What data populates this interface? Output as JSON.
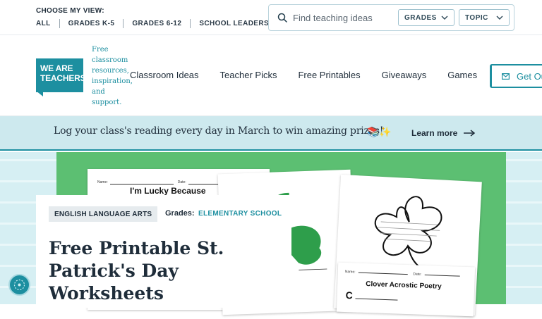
{
  "topbar": {
    "choose_label": "CHOOSE MY VIEW:",
    "views": [
      "ALL",
      "GRADES K-5",
      "GRADES 6-12",
      "SCHOOL LEADERS"
    ],
    "search": {
      "placeholder": "Find teaching ideas",
      "icon": "search-icon"
    },
    "filters": {
      "grades": "GRADES",
      "topic": "TOPIC"
    }
  },
  "brand": {
    "logo_line1": "WE ARE",
    "logo_line2": "TEACHERS",
    "tagline": "Free classroom resources, inspiration, and support.",
    "color": "#1d8fa0"
  },
  "nav": {
    "items": [
      "Classroom Ideas",
      "Teacher Picks",
      "Free Printables",
      "Giveaways",
      "Games"
    ],
    "cta": "Get Ou"
  },
  "banner": {
    "text": "Log your class's reading every day in March to win amazing prizes!",
    "emoji": "📚✨",
    "link": "Learn more"
  },
  "hero": {
    "accent_green": "#5cbf72",
    "worksheet1_title": "I'm Lucky Because",
    "worksheet1_name": "Name:",
    "worksheet1_date": "Date:",
    "worksheet4_title": "Clover Acrostic Poetry",
    "worksheet4_letter": "C",
    "worksheet4_name": "Name:",
    "worksheet4_date": "Date:"
  },
  "article": {
    "category": "ENGLISH LANGUAGE ARTS",
    "grades_label": "Grades:",
    "grades_value": "ELEMENTARY SCHOOL",
    "title": "Free Printable St. Patrick's Day Worksheets"
  }
}
